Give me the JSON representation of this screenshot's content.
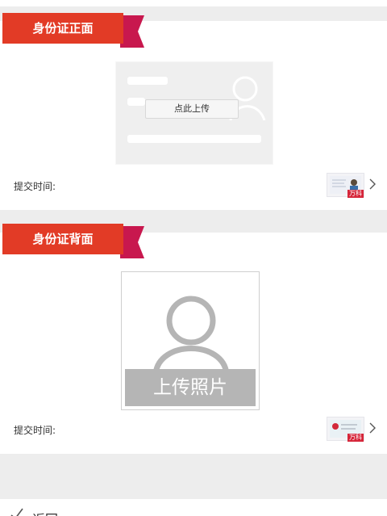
{
  "front_section": {
    "title": "身份证正面",
    "upload_label": "点此上传",
    "submit_time_label": "提交时间:",
    "thumbnail_tag": "万科"
  },
  "back_section": {
    "title": "身份证背面",
    "upload_photo_label": "上传照片",
    "submit_time_label": "提交时间:",
    "thumbnail_tag": "万科"
  },
  "footer": {
    "back_label": "返回"
  },
  "colors": {
    "ribbon_red": "#e23b26",
    "ribbon_tail": "#c8184e",
    "background": "#ededed"
  }
}
